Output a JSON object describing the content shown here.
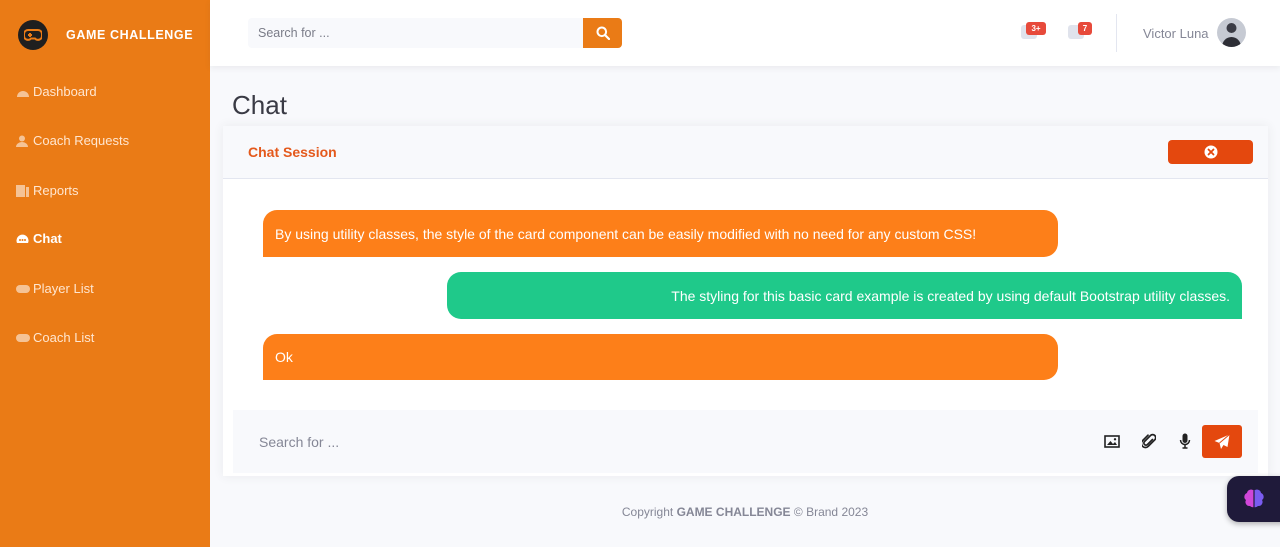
{
  "brand": {
    "name": "GAME CHALLENGE"
  },
  "sidebar": {
    "items": [
      {
        "label": "Dashboard",
        "icon": "dashboard-icon"
      },
      {
        "label": "Coach Requests",
        "icon": "user-icon"
      },
      {
        "label": "Reports",
        "icon": "reports-icon"
      },
      {
        "label": "Chat",
        "icon": "chat-icon",
        "active": true
      },
      {
        "label": "Player List",
        "icon": "gamepad-icon"
      },
      {
        "label": "Coach List",
        "icon": "gamepad-icon"
      }
    ]
  },
  "topbar": {
    "search_placeholder": "Search for ...",
    "alerts_badge": "3+",
    "messages_badge": "7",
    "user_name": "Victor Luna"
  },
  "page": {
    "title": "Chat"
  },
  "chat": {
    "header_title": "Chat Session",
    "messages": [
      {
        "direction": "in",
        "text": "By using utility classes, the style of the card component can be easily modified with no need for any custom CSS!"
      },
      {
        "direction": "out",
        "text": "The styling for this basic card example is created by using default Bootstrap utility classes."
      },
      {
        "direction": "in",
        "text": "Ok"
      }
    ],
    "composer_placeholder": "Search for ..."
  },
  "footer": {
    "prefix": "Copyright",
    "brand": "GAME CHALLENGE",
    "suffix": "© Brand 2023"
  },
  "colors": {
    "sidebar": "#ea7b16",
    "accent": "#e4480e",
    "incoming": "#fd7f19",
    "outgoing": "#1fc98a"
  }
}
